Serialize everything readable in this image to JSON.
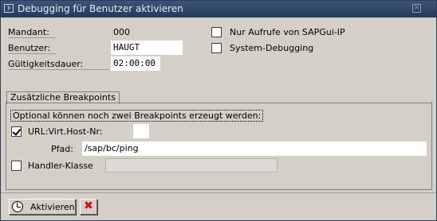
{
  "window": {
    "title": "Debugging für Benutzer aktivieren",
    "close_symbol": "×"
  },
  "form": {
    "mandant_label": "Mandant:",
    "mandant_value": "000",
    "benutzer_label": "Benutzer:",
    "benutzer_value": "HAUGT",
    "gueltigkeit_label": "Gültigkeitsdauer:",
    "gueltigkeit_value": "02:00:00",
    "only_sapgui_label": "Nur Aufrufe von SAPGui-IP",
    "only_sapgui_checked": false,
    "system_debug_label": "System-Debugging",
    "system_debug_checked": false
  },
  "breakpoints": {
    "group_title": "Zusätzliche Breakpoints",
    "note": "Optional können noch zwei Breakpoints erzeugt werden:",
    "url_label": "URL:Virt.Host-Nr:",
    "url_checked": true,
    "host_value": "",
    "pfad_label": "Pfad:",
    "pfad_value": "/sap/bc/ping",
    "handler_label": "Handler-Klasse",
    "handler_checked": false,
    "handler_value": ""
  },
  "footer": {
    "activate_label": "Aktivieren",
    "cancel_symbol": "✖"
  },
  "colors": {
    "titlebar": "#2f4568",
    "body": "#d4d0c8",
    "cancel": "#d01010"
  }
}
